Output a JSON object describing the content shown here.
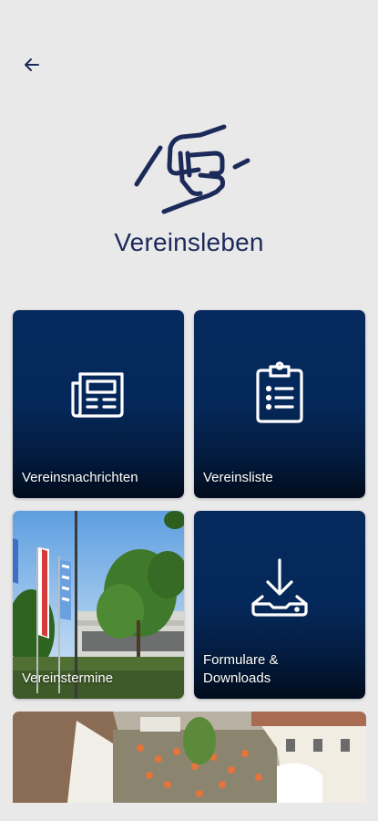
{
  "page": {
    "title": "Vereinsleben"
  },
  "tiles": [
    {
      "label": "Vereinsnachrichten",
      "icon": "newspaper-icon"
    },
    {
      "label": "Vereinsliste",
      "icon": "clipboard-list-icon"
    },
    {
      "label": "Vereinstermine",
      "icon": "photo"
    },
    {
      "label": "Formulare & Downloads",
      "icon": "download-icon"
    }
  ],
  "colors": {
    "primary": "#05285a",
    "title": "#1c2a5a",
    "background": "#e9e9ea"
  }
}
